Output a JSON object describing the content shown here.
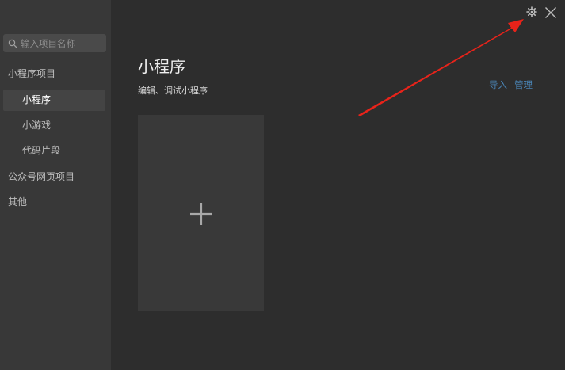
{
  "search": {
    "placeholder": "输入项目名称",
    "icon": "search-icon"
  },
  "sidebar": {
    "items": [
      {
        "label": "小程序项目",
        "level": "group"
      },
      {
        "label": "小程序",
        "level": "sub",
        "active": true
      },
      {
        "label": "小游戏",
        "level": "sub"
      },
      {
        "label": "代码片段",
        "level": "sub"
      },
      {
        "label": "公众号网页项目",
        "level": "group"
      },
      {
        "label": "其他",
        "level": "group"
      }
    ]
  },
  "main": {
    "title": "小程序",
    "subtitle": "编辑、调试小程序",
    "actions": {
      "import_label": "导入",
      "manage_label": "管理"
    },
    "new_project_icon": "plus-icon"
  },
  "window": {
    "settings_icon": "gear-icon",
    "close_icon": "close-icon"
  },
  "annotation": {
    "arrow_color": "#e8231a"
  },
  "colors": {
    "background": "#2d2d2d",
    "sidebar": "#383838",
    "link": "#4a86b8"
  }
}
